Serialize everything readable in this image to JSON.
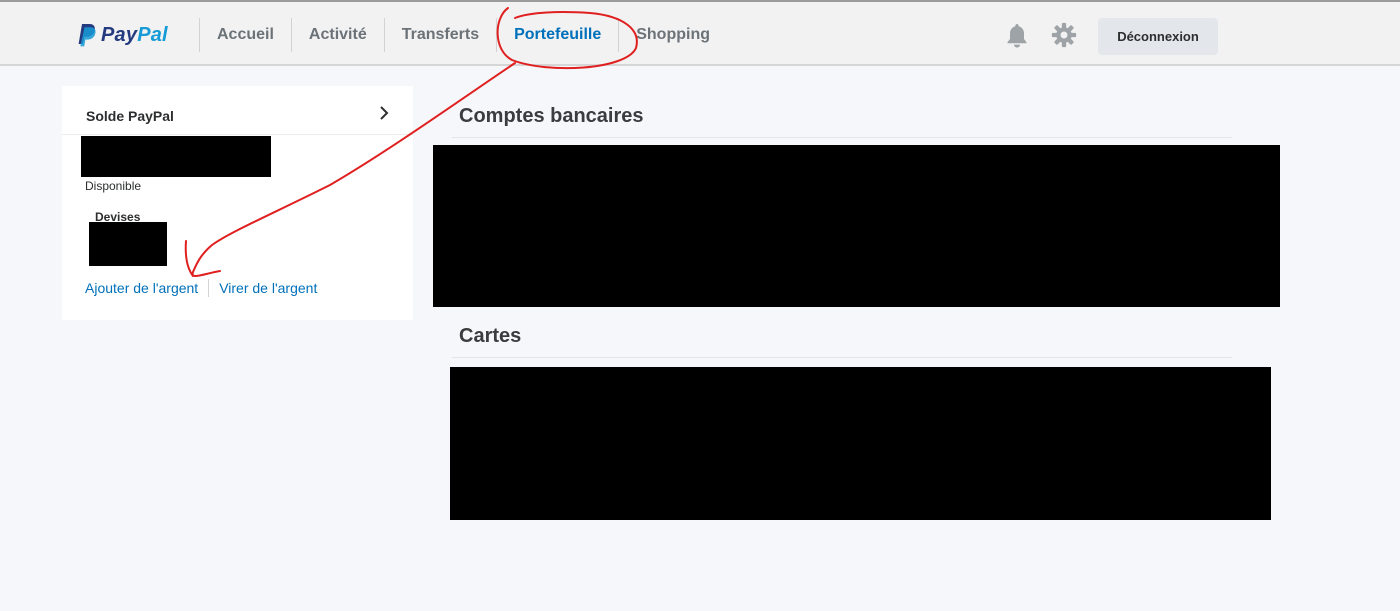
{
  "brand": {
    "name_part1": "Pay",
    "name_part2": "Pal"
  },
  "nav": [
    {
      "label": "Accueil",
      "active": false
    },
    {
      "label": "Activité",
      "active": false
    },
    {
      "label": "Transferts",
      "active": false
    },
    {
      "label": "Portefeuille",
      "active": true
    },
    {
      "label": "Shopping",
      "active": false
    }
  ],
  "header": {
    "notifications_icon": "bell-icon",
    "settings_icon": "gear-icon",
    "logout_label": "Déconnexion"
  },
  "balance_card": {
    "title": "Solde PayPal",
    "chevron_icon": "chevron-right-icon",
    "available_label": "Disponible",
    "currencies_label": "Devises",
    "add_money_label": "Ajouter de l'argent",
    "withdraw_money_label": "Virer de l'argent"
  },
  "sections": {
    "bank_accounts_title": "Comptes bancaires",
    "cards_title": "Cartes"
  },
  "colors": {
    "brand_dark_blue": "#253b80",
    "brand_light_blue": "#179bd7",
    "link_blue": "#0070ba",
    "annotation_red": "#e02020"
  }
}
